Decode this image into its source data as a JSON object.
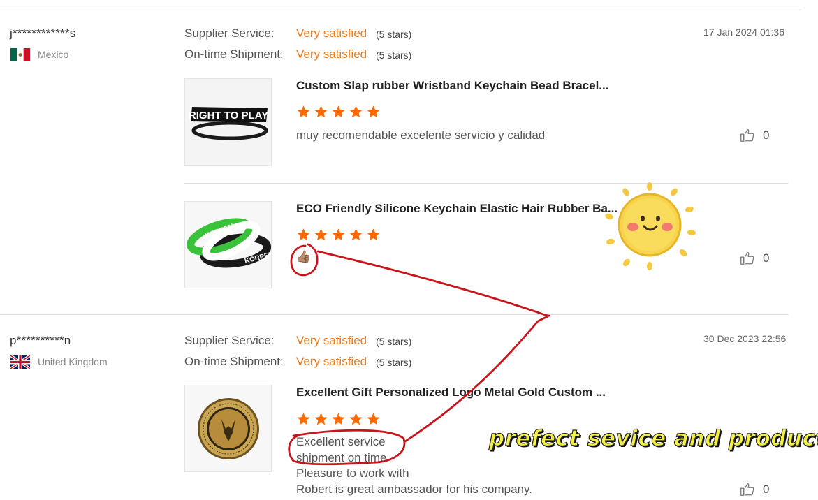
{
  "reviews": [
    {
      "username": "j************s",
      "country": "Mexico",
      "date": "17 Jan 2024 01:36",
      "supplier_label": "Supplier Service:",
      "supplier_value": "Very satisfied",
      "supplier_stars": "(5 stars)",
      "shipment_label": "On-time Shipment:",
      "shipment_value": "Very satisfied",
      "shipment_stars": "(5 stars)",
      "products": [
        {
          "title": "Custom Slap rubber Wristband Keychain Bead Bracel...",
          "rating": 5,
          "comment": "muy recomendable excelente servicio y calidad",
          "likes": "0",
          "image_text": "RIGHT TO PLAY"
        },
        {
          "title": "ECO Friendly Silicone Keychain Elastic Hair Rubber Ba...",
          "rating": 5,
          "comment_emoji": "👍🏽",
          "likes": "0",
          "image_text": "KORPEN"
        }
      ]
    },
    {
      "username": "p**********n",
      "country": "United Kingdom",
      "date": "30 Dec 2023 22:56",
      "supplier_label": "Supplier Service:",
      "supplier_value": "Very satisfied",
      "supplier_stars": "(5 stars)",
      "shipment_label": "On-time Shipment:",
      "shipment_value": "Very satisfied",
      "shipment_stars": "(5 stars)",
      "products": [
        {
          "title": "Excellent Gift Personalized Logo Metal Gold Custom ...",
          "rating": 5,
          "comment_lines": [
            "Excellent service",
            "shipment on time",
            "Pleasure to work with",
            "Robert is great ambassador for his company."
          ],
          "likes": "0"
        }
      ]
    }
  ],
  "overlay": {
    "caption": "prefect sevice and product"
  },
  "colors": {
    "accent": "#ee7a1d",
    "star": "#ff6a00",
    "annotation": "#c8141a"
  }
}
